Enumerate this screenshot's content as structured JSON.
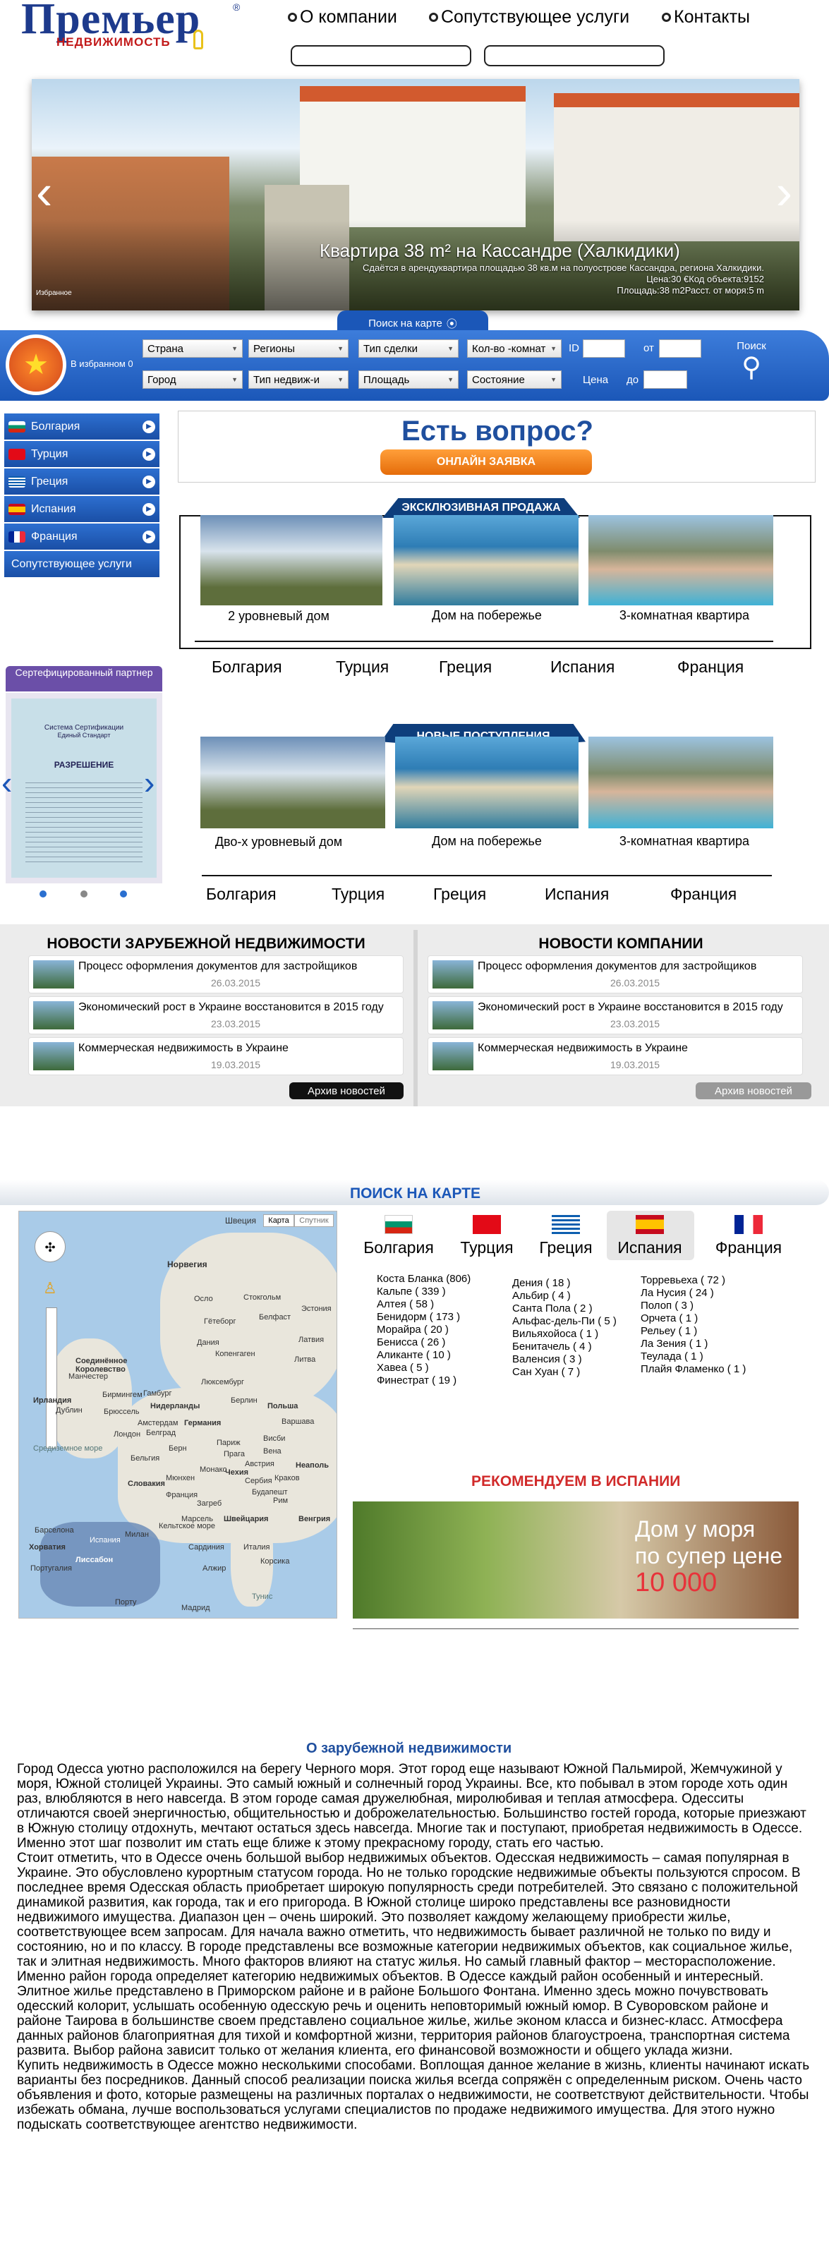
{
  "logo": {
    "word": "Премьер",
    "sub": "НЕДВИЖИМОСТЬ",
    "reg": "®"
  },
  "topnav": [
    "О компании",
    "Сопутствующее услуги",
    "Контакты"
  ],
  "hero": {
    "title": "Квартира 38 m² на Кассандре (Халкидики)",
    "desc": "Сдаётся в арендуквартира площадью 38 кв.м на полуострове Кассандра, регионa Халкидики.",
    "price": "Цена:30 €Код объекта:9152",
    "area": "Площадь:38 m2Расст. от моря:5 m",
    "fav": "Избранное"
  },
  "search": {
    "tab": "Поиск на карте",
    "fav_count": "В избранном 0",
    "row1": [
      "Страна",
      "Регионы",
      "Тип сделки",
      "Кол-во -комнат"
    ],
    "row2": [
      "Город",
      "Тип недвиж-и",
      "Площадь",
      "Состояние"
    ],
    "id_label": "ID",
    "from": "от",
    "price_label": "Цена",
    "to": "до",
    "button": "Поиск"
  },
  "sidebar": {
    "items": [
      "Болгария",
      "Турция",
      "Греция",
      "Испания",
      "Франция",
      "Сопутствующее услуги"
    ]
  },
  "question": {
    "title": "Есть вопрос?",
    "button": "ОНЛАЙН ЗАЯВКА"
  },
  "exclusive": {
    "tab": "ЭКСКЛЮЗИВНАЯ ПРОДАЖА",
    "items": [
      "2 уровневый дом",
      "Дом на побережье",
      "3-комнатная квартира"
    ],
    "countries": [
      "Болгария",
      "Турция",
      "Греция",
      "Испания",
      "Франция"
    ]
  },
  "certificate": {
    "head": "Сертефицированный партнер",
    "doc": [
      "Система Сертификации",
      "Единый Стандарт",
      "РАЗРЕШЕНИЕ"
    ]
  },
  "newarrivals": {
    "tab": "НОВЫЕ ПОСТУПЛЕНИЯ",
    "items": [
      "Дво-х уровневый дом",
      "Дом на побережье",
      "3-комнатная квартира"
    ],
    "countries": [
      "Болгария",
      "Турция",
      "Греция",
      "Испания",
      "Франция"
    ]
  },
  "news": {
    "left_title": "НОВОСТИ ЗАРУБЕЖНОЙ НЕДВИЖИМОСТИ",
    "right_title": "НОВОСТИ КОМПАНИИ",
    "items": [
      {
        "title": "Процесс оформления документов для застройщиков",
        "date": "26.03.2015"
      },
      {
        "title": "Экономический рост в Украине восстановится в 2015 году",
        "date": "23.03.2015"
      },
      {
        "title": "Коммерческая недвижимость в Украине",
        "date": "19.03.2015"
      }
    ],
    "archive": "Архив новостей"
  },
  "mapsection": {
    "title": "ПОИСК НА КАРТЕ",
    "map_buttons": [
      "Карта",
      "Спутник"
    ],
    "map_labels": [
      "Швеция",
      "Норвегия",
      "Стокгольм",
      "Осло",
      "Гётеборг",
      "Эстония",
      "Латвия",
      "Литва",
      "Дания",
      "Копенгаген",
      "Соединённое Королевство",
      "Ирландия",
      "Дублин",
      "Лондон",
      "Нидерланды",
      "Германия",
      "Берлин",
      "Польша",
      "Варшава",
      "Белград",
      "Бельгия",
      "Париж",
      "Прага",
      "Чехия",
      "Австрия",
      "Вена",
      "Словакия",
      "Франция",
      "Швейцария",
      "Италия",
      "Рим",
      "Хорватия",
      "Португалия",
      "Лиссабон",
      "Испания",
      "Мадрид",
      "Тунис",
      "Средиземное море",
      "Кельтское море",
      "Марсель",
      "Монако",
      "Мюнхен",
      "Берн",
      "Люксембург",
      "Гамбург",
      "Амстердам",
      "Брюссель",
      "Бирмингем",
      "Манчестер",
      "Белфаст",
      "Висби",
      "Краков",
      "Будапешт",
      "Загреб",
      "Милан",
      "Барселона",
      "Порту",
      "Алжир",
      "Сардиния",
      "Корсика",
      "Неаполь",
      "Венгрия",
      "Сербия",
      "Словения"
    ],
    "countries": [
      "Болгария",
      "Турция",
      "Греция",
      "Испания",
      "Франция"
    ],
    "col1": [
      "Коста Бланка (806)",
      "Кальпе ( 339 )",
      "Алтея ( 58 )",
      "Бенидорм ( 173 )",
      "Морайра ( 20 )",
      "Бенисса ( 26 )",
      "Аликанте ( 10 )",
      "Хавеа ( 5 )",
      "Финестрат ( 19 )"
    ],
    "col2": [
      "Дения ( 18 )",
      "Альбир ( 4 )",
      "Санта Пола ( 2 )",
      "Альфас-дель-Пи ( 5 )",
      "Вильяхойоса ( 1 )",
      "Бенитачель ( 4 )",
      "Валенсия ( 3 )",
      "Сан Хуан ( 7 )"
    ],
    "col3": [
      "Торревьеха ( 72 )",
      "Ла Нусия ( 24 )",
      "Полоп ( 3 )",
      "Орчета ( 1 )",
      "Рельеу ( 1 )",
      "Ла Зения ( 1 )",
      "Теулада ( 1 )",
      "Плайя Фламенко ( 1 )"
    ],
    "recommend": "РЕКОМЕНДУЕМ В ИСПАНИИ",
    "rec_text": [
      "Дом у моря",
      "по супер цене",
      "10 000"
    ]
  },
  "about": {
    "title": "О зарубежной недвижимости",
    "paragraphs": [
      "Город Одесса уютно расположился на берегу Черного моря. Этот город еще называют Южной Пальмирой, Жемчужиной у моря, Южной столицей Украины. Это самый южный и солнечный город Украины. Все, кто побывал в этом городе хоть один раз, влюбляются в него навсегда. В этом городе самая дружелюбная, миролюбивая и теплая атмосфера. Одесситы отличаются своей энергичностью, общительностью и доброжелательностью. Большинство гостей города, которые приезжают в Южную столицу отдохнуть, мечтают остаться здесь навсегда. Многие так и поступают, приобретая недвижимость в Одессе. Именно этот шаг позволит им стать еще ближе к этому прекрасному городу, стать его частью.",
      "Стоит отметить, что в Одессе очень большой выбор недвижимых объектов. Одесская недвижимость – самая популярная в Украине. Это обусловлено курортным статусом города. Но не только городские недвижимые объекты пользуются спросом. В последнее время Одесская область приобретает широкую популярность среди потребителей. Это связано с положительной динамикой развития, как города, так и его пригорода. В Южной столице широко представлены все разновидности недвижимого имущества. Диапазон цен – очень широкий. Это позволяет каждому желающему приобрести жилье, соответствующее всем запросам. Для начала важно отметить, что недвижимость бывает различной не только по виду и состоянию, но и по классу. В городе представлены все возможные категории недвижимых объектов, как социальное жилье, так и элитная недвижимость. Много факторов влияют на статус жилья. Но самый главный фактор – месторасположение. Именно район города определяет категорию недвижимых объектов. В Одессе каждый район особенный и интересный. Элитное жилье представлено в Приморском районе и в районе Большого Фонтана. Именно здесь можно почувствовать одесский колорит, услышать особенную одесскую речь и оценить неповторимый южный юмор. В Суворовском районе  и районе Таирова в большинстве своем представлено социальное жилье, жилье эконом класса и бизнес-класс. Атмосфера данных районов благоприятная для тихой и комфортной жизни, территория районов благоустроена, транспортная система развита. Выбор района зависит только от желания клиента, его финансовой возможности и общего уклада жизни.",
      "Купить недвижимость в Одессе можно несколькими способами. Воплощая данное желание в жизнь, клиенты начинают искать варианты без посредников. Данный способ реализации поиска жилья всегда сопряжён с определенным риском. Очень часто объявления и фото, которые размещены на различных порталах о недвижимости, не соответствуют действительности. Чтобы избежать обмана, лучше воспользоваться услугами специалистов по продаже недвижимого имущества. Для этого нужно подыскать соответствующее агентство недвижимости."
    ]
  },
  "colors": {
    "brand_blue": "#1b57b8",
    "accent_orange": "#e56c0a",
    "title_blue": "#1f4f9e",
    "rec_red": "#d12a2a"
  }
}
